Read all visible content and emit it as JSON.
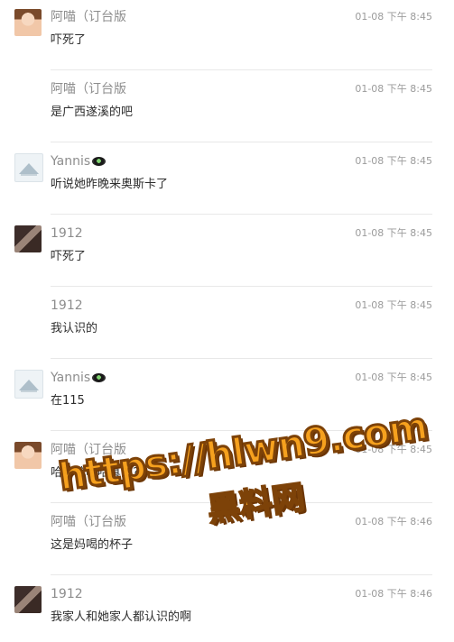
{
  "messages": [
    {
      "name": "阿喵（订台版",
      "time": "01-08 下午 8:45",
      "text": "吓死了",
      "avatar": "child-avatar",
      "emoji": ""
    },
    {
      "name": "阿喵（订台版",
      "time": "01-08 下午 8:45",
      "text": "是广西遂溪的吧",
      "avatar": "",
      "emoji": ""
    },
    {
      "name": "Yannis",
      "time": "01-08 下午 8:45",
      "text": "听说她昨晚来奥斯卡了",
      "avatar": "mountain-avatar",
      "emoji": "ufo-emoji"
    },
    {
      "name": "1912",
      "time": "01-08 下午 8:45",
      "text": "吓死了",
      "avatar": "girl-avatar",
      "emoji": ""
    },
    {
      "name": "1912",
      "time": "01-08 下午 8:45",
      "text": "我认识的",
      "avatar": "",
      "emoji": ""
    },
    {
      "name": "Yannis",
      "time": "01-08 下午 8:45",
      "text": "在115",
      "avatar": "mountain-avatar",
      "emoji": "ufo-emoji"
    },
    {
      "name": "阿喵（订台版",
      "time": "01-08 下午 8:45",
      "text": "哈哈哈哈哈真的?",
      "avatar": "child-avatar",
      "emoji": ""
    },
    {
      "name": "阿喵（订台版",
      "time": "01-08 下午 8:46",
      "text": "这是妈喝的杯子",
      "avatar": "",
      "emoji": ""
    },
    {
      "name": "1912",
      "time": "01-08 下午 8:46",
      "text": "我家人和她家人都认识的啊",
      "avatar": "girl-avatar",
      "emoji": ""
    }
  ],
  "watermark": {
    "line1": "https://hlwn9.com",
    "line2": "黑料网"
  }
}
